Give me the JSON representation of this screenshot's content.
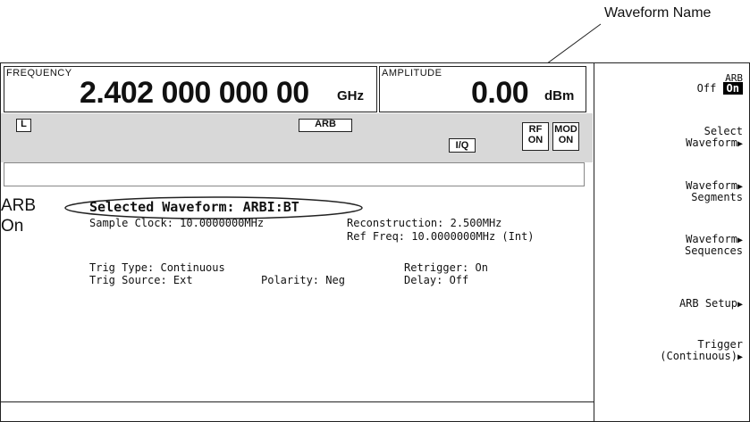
{
  "callout": {
    "label": "Waveform Name"
  },
  "frequency": {
    "label": "FREQUENCY",
    "value": "2.402 000 000 00",
    "unit": "GHz"
  },
  "amplitude": {
    "label": "AMPLITUDE",
    "value": "0.00",
    "unit": "dBm"
  },
  "annunciators": {
    "local": "L",
    "arb": "ARB",
    "iq": "I/Q",
    "rf_line1": "RF",
    "rf_line2": "ON",
    "mod_line1": "MOD",
    "mod_line2": "ON"
  },
  "status": {
    "mode_line1": "ARB",
    "mode_line2": "On",
    "selected_waveform": "Selected Waveform: ARBI:BT",
    "sample_clock": "Sample Clock: 10.0000000MHz",
    "reconstruction": "Reconstruction: 2.500MHz",
    "ref_freq": "Ref Freq: 10.0000000MHz (Int)",
    "trig_type": "Trig Type: Continuous",
    "retrigger": "Retrigger: On",
    "trig_source": "Trig Source: Ext",
    "polarity": "Polarity: Neg",
    "delay": "Delay: Off"
  },
  "softkeys": {
    "arb_label": "ARB",
    "arb_off": "Off",
    "arb_on": "On",
    "select_waveform_line1": "Select",
    "select_waveform_line2": "Waveform",
    "waveform_segments_line1": "Waveform",
    "waveform_segments_line2": "Segments",
    "waveform_sequences_line1": "Waveform",
    "waveform_sequences_line2": "Sequences",
    "arb_setup": "ARB Setup",
    "trigger_line1": "Trigger",
    "trigger_line2": "(Continuous)"
  },
  "colors": {
    "status_bar": "#d8d8d8",
    "highlight": "#000000"
  }
}
